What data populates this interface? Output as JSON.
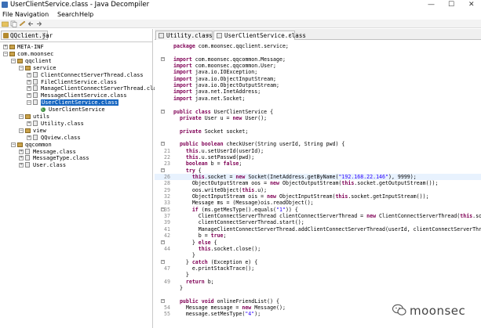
{
  "window": {
    "title": "UserClientService.class - Java Decompiler",
    "minimize": "—",
    "maximize": "☐",
    "close": "✕"
  },
  "menubar": [
    "File",
    "Navigation",
    "Search",
    "Help"
  ],
  "toolbar": {
    "icons": [
      "open-file-icon",
      "copy-icon",
      "save-icon",
      "back-icon",
      "forward-icon"
    ]
  },
  "left_tab": {
    "label": "QQclient.jar",
    "close": "✕"
  },
  "tree": [
    {
      "label": "META-INF",
      "icon": "package",
      "expander": "+",
      "depth": 0
    },
    {
      "label": "com.moonsec",
      "icon": "package",
      "expander": "−",
      "depth": 0
    },
    {
      "label": "qqclient",
      "icon": "package",
      "expander": "−",
      "depth": 1
    },
    {
      "label": "service",
      "icon": "package",
      "expander": "−",
      "depth": 2
    },
    {
      "label": "ClientConnectServerThread.class",
      "icon": "class-file",
      "expander": "+",
      "depth": 3
    },
    {
      "label": "FileClientService.class",
      "icon": "class-file",
      "expander": "+",
      "depth": 3
    },
    {
      "label": "ManageClientConnectServerThread.class",
      "icon": "class-file",
      "expander": "+",
      "depth": 3
    },
    {
      "label": "MessageClientService.class",
      "icon": "class-file",
      "expander": "+",
      "depth": 3
    },
    {
      "label": "UserClientService.class",
      "icon": "class-file",
      "expander": "−",
      "depth": 3,
      "selected": true
    },
    {
      "label": "UserClientService",
      "icon": "class",
      "expander": "",
      "depth": 4
    },
    {
      "label": "utils",
      "icon": "package",
      "expander": "−",
      "depth": 2
    },
    {
      "label": "Utility.class",
      "icon": "class-file",
      "expander": "+",
      "depth": 3
    },
    {
      "label": "view",
      "icon": "package",
      "expander": "−",
      "depth": 2
    },
    {
      "label": "QQview.class",
      "icon": "class-file",
      "expander": "+",
      "depth": 3
    },
    {
      "label": "qqcommon",
      "icon": "package",
      "expander": "−",
      "depth": 1
    },
    {
      "label": "Message.class",
      "icon": "class-file",
      "expander": "+",
      "depth": 2
    },
    {
      "label": "MessageType.class",
      "icon": "class-file",
      "expander": "+",
      "depth": 2
    },
    {
      "label": "User.class",
      "icon": "class-file",
      "expander": "+",
      "depth": 2
    }
  ],
  "editor_tabs": [
    {
      "label": "Utility.class",
      "close": "✕",
      "active": false
    },
    {
      "label": "UserClientService.class",
      "close": "✕",
      "active": true
    }
  ],
  "code_lines": [
    {
      "ln": "",
      "text": "package com.moonsec.qqclient.service;",
      "fold": ""
    },
    {
      "ln": "",
      "text": "",
      "fold": ""
    },
    {
      "ln": "",
      "text": "import com.moonsec.qqcommon.Message;",
      "fold": "−"
    },
    {
      "ln": "",
      "text": "import com.moonsec.qqcommon.User;",
      "fold": ""
    },
    {
      "ln": "",
      "text": "import java.io.IOException;",
      "fold": ""
    },
    {
      "ln": "",
      "text": "import java.io.ObjectInputStream;",
      "fold": ""
    },
    {
      "ln": "",
      "text": "import java.io.ObjectOutputStream;",
      "fold": ""
    },
    {
      "ln": "",
      "text": "import java.net.InetAddress;",
      "fold": ""
    },
    {
      "ln": "",
      "text": "import java.net.Socket;",
      "fold": ""
    },
    {
      "ln": "",
      "text": "",
      "fold": ""
    },
    {
      "ln": "",
      "text": "public class UserClientService {",
      "fold": "−"
    },
    {
      "ln": "",
      "text": "  private User u = new User();",
      "fold": ""
    },
    {
      "ln": "",
      "text": "",
      "fold": ""
    },
    {
      "ln": "",
      "text": "  private Socket socket;",
      "fold": ""
    },
    {
      "ln": "",
      "text": "",
      "fold": ""
    },
    {
      "ln": "",
      "text": "  public boolean checkUser(String userId, String pwd) {",
      "fold": "−"
    },
    {
      "ln": "21",
      "text": "    this.u.setUserId(userId);",
      "fold": ""
    },
    {
      "ln": "22",
      "text": "    this.u.setPasswd(pwd);",
      "fold": ""
    },
    {
      "ln": "23",
      "text": "    boolean b = false;",
      "fold": ""
    },
    {
      "ln": "",
      "text": "    try {",
      "fold": "−"
    },
    {
      "ln": "26",
      "text": "      this.socket = new Socket(InetAddress.getByName(\"192.168.22.146\"), 9999);",
      "fold": "",
      "hl": true
    },
    {
      "ln": "28",
      "text": "      ObjectOutputStream oos = new ObjectOutputStream(this.socket.getOutputStream());",
      "fold": ""
    },
    {
      "ln": "29",
      "text": "      oos.writeObject(this.u);",
      "fold": ""
    },
    {
      "ln": "32",
      "text": "      ObjectInputStream ois = new ObjectInputStream(this.socket.getInputStream());",
      "fold": ""
    },
    {
      "ln": "33",
      "text": "      Message ms = (Message)ois.readObject();",
      "fold": ""
    },
    {
      "ln": "35",
      "text": "      if (ms.getMesType().equals(\"1\")) {",
      "fold": "−"
    },
    {
      "ln": "37",
      "text": "        ClientConnectServerThread clientConnectServerThread = new ClientConnectServerThread(this.socket);",
      "fold": ""
    },
    {
      "ln": "39",
      "text": "        clientConnectServerThread.start();",
      "fold": ""
    },
    {
      "ln": "41",
      "text": "        ManageClientConnectServerThread.addClientConnectServerThread(userId, clientConnectServerThread);",
      "fold": ""
    },
    {
      "ln": "42",
      "text": "        b = true;",
      "fold": ""
    },
    {
      "ln": "",
      "text": "      } else {",
      "fold": "−"
    },
    {
      "ln": "44",
      "text": "        this.socket.close();",
      "fold": ""
    },
    {
      "ln": "",
      "text": "      }",
      "fold": ""
    },
    {
      "ln": "",
      "text": "    } catch (Exception e) {",
      "fold": "−"
    },
    {
      "ln": "47",
      "text": "      e.printStackTrace();",
      "fold": ""
    },
    {
      "ln": "",
      "text": "    }",
      "fold": ""
    },
    {
      "ln": "49",
      "text": "    return b;",
      "fold": ""
    },
    {
      "ln": "",
      "text": "  }",
      "fold": ""
    },
    {
      "ln": "",
      "text": "",
      "fold": ""
    },
    {
      "ln": "",
      "text": "  public void onlineFriendList() {",
      "fold": "−"
    },
    {
      "ln": "54",
      "text": "    Message message = new Message();",
      "fold": ""
    },
    {
      "ln": "55",
      "text": "    message.setMesType(\"4\");",
      "fold": ""
    }
  ],
  "watermark": {
    "text": "moonsec"
  },
  "colors": {
    "selection": "#1565c0",
    "highlight_line": "#e8f2fe",
    "keyword": "#7f0055",
    "field": "#0000c0",
    "string": "#2a00ff"
  }
}
